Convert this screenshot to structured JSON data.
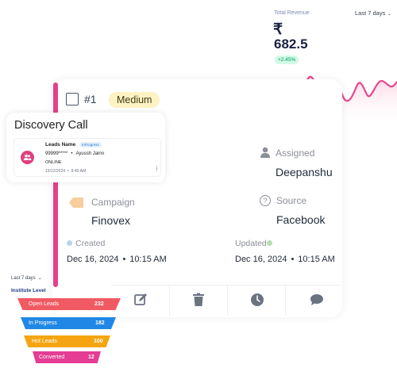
{
  "revenue": {
    "label": "Total Revenue",
    "range": "Last 7 days",
    "currency": "₹",
    "value": "682.5",
    "change": "+2.45%",
    "colors": {
      "line": "#e8478c",
      "fill": "#fde2ec"
    }
  },
  "lead": {
    "number": "#1",
    "priority": "Medium",
    "assigned_label": "Assigned",
    "assigned_value": "Deepanshu",
    "campaign_label": "Campaign",
    "campaign_value": "Finovex",
    "source_label": "Source",
    "source_value": "Facebook",
    "created_label": "Created",
    "created_date": "Dec 16, 2024",
    "created_time": "10:15 AM",
    "updated_label": "Updated",
    "updated_date": "Dec 16, 2024",
    "updated_time": "10:15 AM",
    "separator": "•",
    "actions": [
      "edit-icon",
      "trash-icon",
      "clock-icon",
      "comment-icon"
    ],
    "colors": {
      "accent": "#e4408f",
      "priority_bg": "#fdf2c2",
      "created_dot": "#b9d3ee",
      "updated_dot": "#b7dfa9"
    }
  },
  "discovery": {
    "title": "Discovery Call",
    "leads_label": "Leads Name",
    "chip": "InProgress",
    "phone": "99999*****",
    "name": "Ayussh Jainn",
    "bullet": "•",
    "status": "ONLINE",
    "date": "15/12/2024",
    "time": "8:40 AM",
    "dt_sep": "•"
  },
  "funnel": {
    "range": "Last 7 days",
    "title": "Institute Level",
    "stages": [
      {
        "label": "Open Leads",
        "value": "232",
        "color": "#f05a63"
      },
      {
        "label": "In Progress",
        "value": "182",
        "color": "#2187e6"
      },
      {
        "label": "Hot Leads",
        "value": "100",
        "color": "#f5a512"
      },
      {
        "label": "Converted",
        "value": "12",
        "color": "#e43d93"
      }
    ]
  }
}
